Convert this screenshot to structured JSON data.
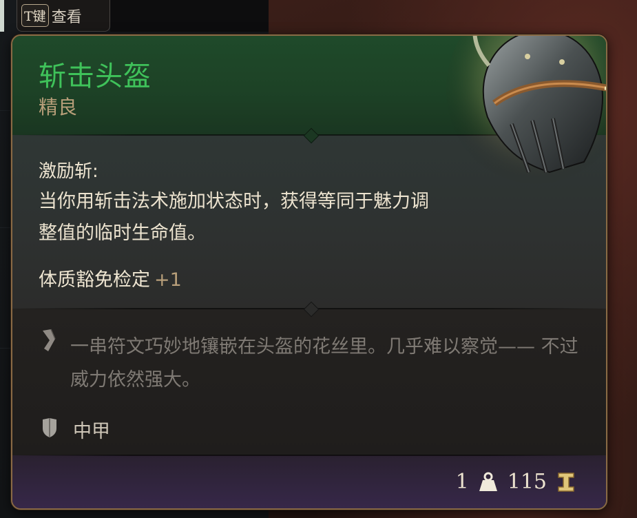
{
  "hint": {
    "key": "T键",
    "label": "查看"
  },
  "item": {
    "name": "斩击头盔",
    "rarity": "精良",
    "effect_name": "激励斩:",
    "effect_description": "当你用斩击法术施加状态时，获得等同于魅力调整值的临时生命值。",
    "bonus_label": "体质豁免检定",
    "bonus_value": "+1",
    "flavor_text": "一串符文巧妙地镶嵌在头盔的花丝里。几乎难以察觉—— 不过威力依然强大。",
    "armor_type": "中甲",
    "weight": "1",
    "value": "115"
  },
  "colors": {
    "rarity_green": "#3fc25a",
    "frame_gold": "#8a6a45",
    "footer_purple": "#37284a"
  },
  "icons": {
    "flavor": "feather-quill-icon",
    "armor": "shield-icon",
    "weight": "weight-icon",
    "value": "gold-coin-icon"
  }
}
